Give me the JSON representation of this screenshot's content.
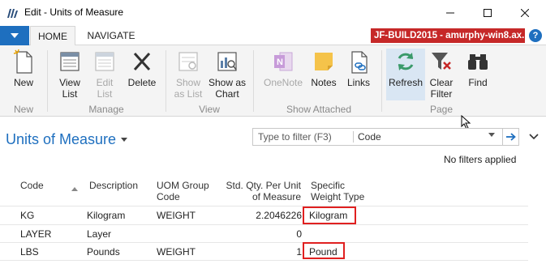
{
  "window": {
    "title": "Edit - Units of Measure",
    "minimize_icon": "minimize-icon",
    "maximize_icon": "maximize-icon",
    "close_icon": "close-icon"
  },
  "ribbon_tabs": {
    "home": "HOME",
    "navigate": "NAVIGATE",
    "server_badge": "JF-BUILD2015 - amurphy-win8.ax...",
    "help": "?"
  },
  "ribbon": {
    "new": "New",
    "view_list_1": "View",
    "view_list_2": "List",
    "edit_list_1": "Edit",
    "edit_list_2": "List",
    "delete": "Delete",
    "show_as_list_1": "Show",
    "show_as_list_2": "as List",
    "show_as_chart_1": "Show as",
    "show_as_chart_2": "Chart",
    "onenote": "OneNote",
    "notes": "Notes",
    "links": "Links",
    "refresh": "Refresh",
    "clear_filter_1": "Clear",
    "clear_filter_2": "Filter",
    "find": "Find",
    "group_new": "New",
    "group_manage": "Manage",
    "group_view": "View",
    "group_show_attached": "Show Attached",
    "group_page": "Page"
  },
  "page": {
    "title": "Units of Measure",
    "filter_placeholder": "Type to filter (F3)",
    "filter_field": "Code",
    "no_filters": "No filters applied"
  },
  "table": {
    "headers": {
      "code": "Code",
      "description": "Description",
      "uom_group_1": "UOM Group",
      "uom_group_2": "Code",
      "std_qty_1": "Std. Qty. Per Unit",
      "std_qty_2": "of Measure",
      "weight_type_1": "Specific",
      "weight_type_2": "Weight Type"
    },
    "rows": [
      {
        "code": "KG",
        "description": "Kilogram",
        "uom_group": "WEIGHT",
        "std_qty": "2.2046226",
        "weight_type": "Kilogram"
      },
      {
        "code": "LAYER",
        "description": "Layer",
        "uom_group": "",
        "std_qty": "0",
        "weight_type": ""
      },
      {
        "code": "LBS",
        "description": "Pounds",
        "uom_group": "WEIGHT",
        "std_qty": "1",
        "weight_type": "Pound"
      }
    ]
  },
  "colors": {
    "accent": "#1e6fbf",
    "server_badge": "#c62828",
    "highlight_box": "#e02020",
    "ribbon_bg": "#f4f4f4"
  }
}
